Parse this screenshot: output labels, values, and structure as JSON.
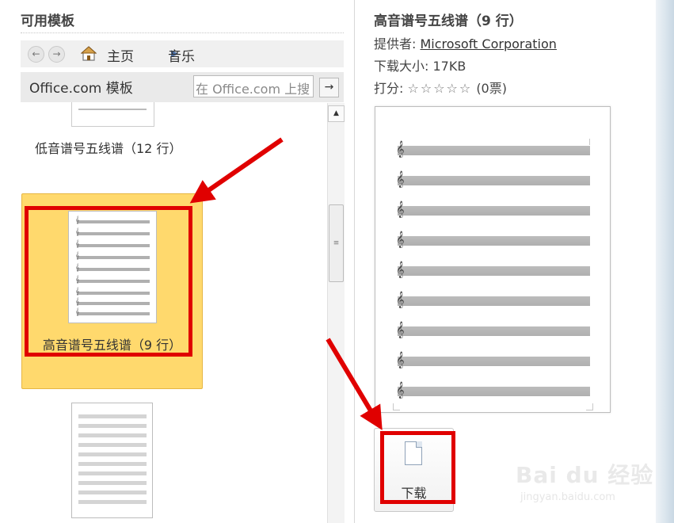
{
  "left_panel": {
    "title": "可用模板",
    "nav": {
      "back_icon": "back-arrow-icon",
      "forward_icon": "forward-arrow-icon",
      "home_icon": "home-icon",
      "home_label": "主页",
      "current_label": "音乐"
    },
    "office_label": "Office.com 模板",
    "search_placeholder": "在 Office.com 上搜",
    "templates": [
      {
        "label": "低音谱号五线谱（12 行）",
        "selected": false
      },
      {
        "label": "高音谱号五线谱（9 行）",
        "selected": true
      }
    ]
  },
  "details": {
    "title": "高音谱号五线谱（9 行）",
    "provider_label": "提供者:",
    "provider": "Microsoft Corporation",
    "size_label": "下载大小:",
    "size": "17KB",
    "rating_label": "打分:",
    "stars": "☆☆☆☆☆",
    "votes": "(0票)",
    "download_label": "下载"
  },
  "watermark": {
    "main": "Bai du 经验",
    "sub": "jingyan.baidu.com"
  },
  "colors": {
    "selected_bg": "#ffd96d",
    "highlight": "#e00000",
    "accent": "#4a6fa5"
  }
}
